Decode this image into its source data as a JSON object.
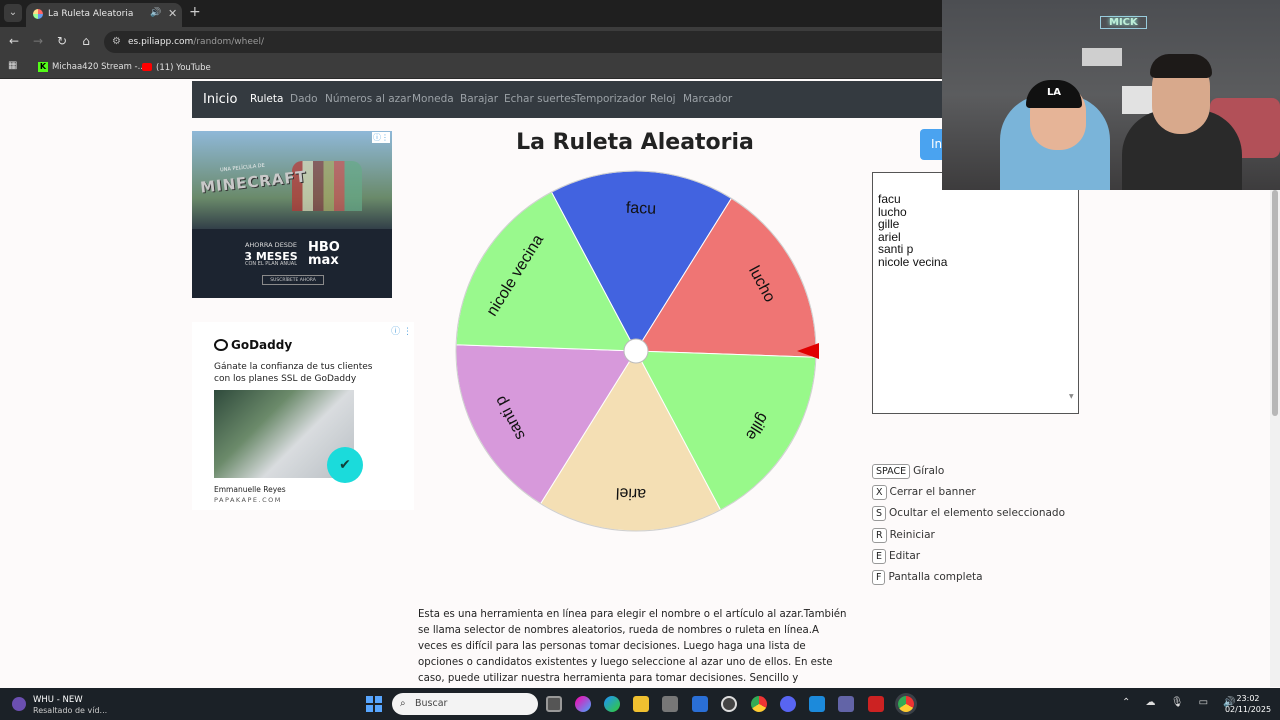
{
  "browser": {
    "tab": {
      "title": "La Ruleta Aleatoria"
    },
    "url": {
      "host": "es.piliapp.com",
      "path": "/random/wheel/"
    },
    "bookmarks": [
      {
        "label": "Michaa420 Stream -..."
      },
      {
        "label": "(11) YouTube"
      }
    ]
  },
  "site_nav": {
    "brand": "Inicio",
    "links": [
      "Ruleta",
      "Dado",
      "Números al azar",
      "Moneda",
      "Barajar",
      "Echar suertes",
      "Temporizador",
      "Reloj",
      "Marcador"
    ],
    "active": "Ruleta"
  },
  "ads": {
    "minecraft": {
      "subtitle": "UNA PELÍCULA DE",
      "title": "MINECRAFT",
      "offer_line1": "AHORRA DESDE",
      "offer_line2": "3 MESES",
      "offer_line3": "CON EL PLAN ANUAL",
      "brand": "HBO max",
      "cta": "SUSCRÍBETE AHORA"
    },
    "godaddy": {
      "brand": "GoDaddy",
      "text": "Gánate la confianza de tus clientes con los planes SSL de GoDaddy",
      "name": "Emmanuelle Reyes",
      "site": "PAPAKAPE.COM"
    }
  },
  "main": {
    "title": "La Ruleta Aleatoria",
    "start_label": "In",
    "names_text": "facu\nlucho\ngille\nariel\nsanti p\nnicole vecina"
  },
  "wheel": {
    "segments": [
      {
        "label": "facu",
        "color": "#4263e0"
      },
      {
        "label": "lucho",
        "color": "#ef7574"
      },
      {
        "label": "gille",
        "color": "#98f98a"
      },
      {
        "label": "ariel",
        "color": "#f4dfb4"
      },
      {
        "label": "santi p",
        "color": "#d799db"
      },
      {
        "label": "nicole vecina",
        "color": "#99f98d"
      }
    ],
    "pointer_color": "#e00000"
  },
  "shortcuts": [
    {
      "key": "SPACE",
      "label": "Gíralo"
    },
    {
      "key": "X",
      "label": "Cerrar el banner"
    },
    {
      "key": "S",
      "label": "Ocultar el elemento seleccionado"
    },
    {
      "key": "R",
      "label": "Reiniciar"
    },
    {
      "key": "E",
      "label": "Editar"
    },
    {
      "key": "F",
      "label": "Pantalla completa"
    }
  ],
  "description": "Esta es una herramienta en línea para elegir el nombre o el artículo al azar.También se llama selector de nombres aleatorios, rueda de nombres o ruleta en línea.A veces es difícil para las personas tomar decisiones. Luego haga una lista de opciones o candidatos existentes y luego seleccione al azar uno de ellos. En este caso, puede utilizar nuestra herramienta para tomar decisiones. Sencillo y divertido.Puede modificar los nombres en textarea, poner un nombre",
  "webcam": {
    "sign": "MICK",
    "cap": "LA"
  },
  "taskbar": {
    "app_title": "WHU - NEW",
    "app_subtitle": "Resaltado de víd...",
    "search_placeholder": "Buscar",
    "time": "23:02",
    "date": "02/11/2025"
  }
}
